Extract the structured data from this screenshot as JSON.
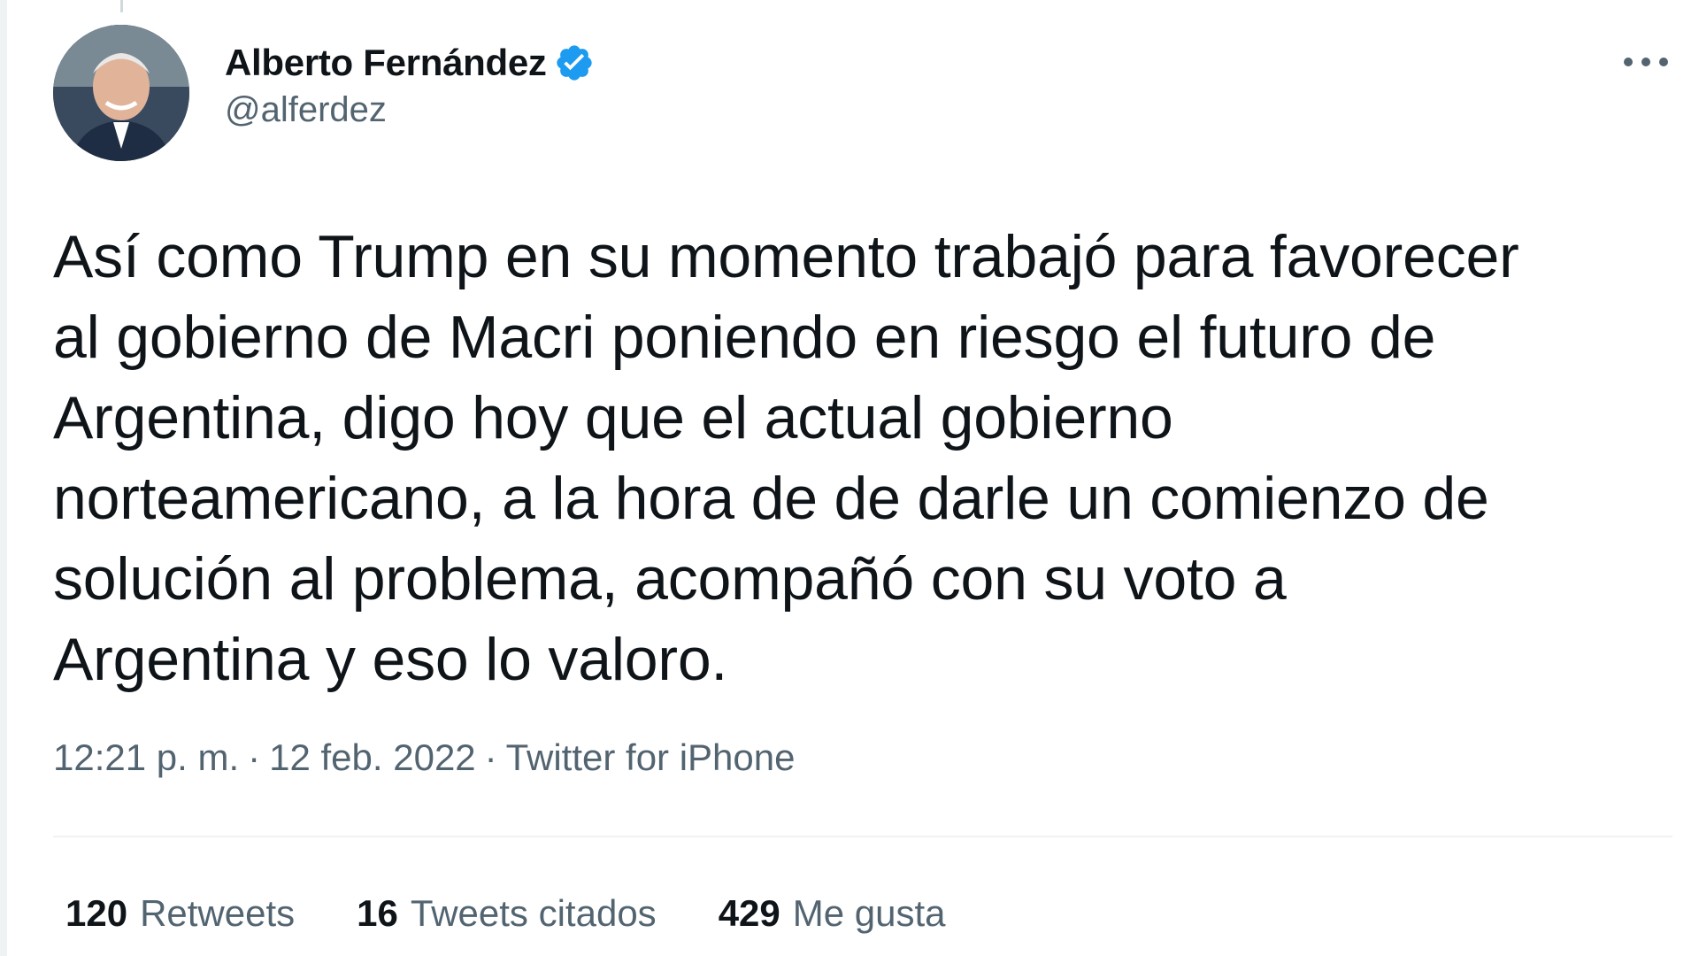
{
  "author": {
    "display_name": "Alberto Fernández",
    "handle": "@alferdez",
    "verified": true,
    "avatar_icon": "profile-photo"
  },
  "tweet": {
    "text": "Así como Trump en su momento trabajó para favorecer\nal gobierno de Macri poniendo en riesgo el futuro de\nArgentina, digo hoy que el actual gobierno\nnorteamericano, a la hora de de darle un comienzo de\nsolución al problema, acompañó con su voto a\nArgentina y eso lo valoro."
  },
  "meta": {
    "time": "12:21 p. m.",
    "separator": "·",
    "date": "12 feb. 2022",
    "source": "Twitter for iPhone"
  },
  "stats": [
    {
      "count": "120",
      "label": "Retweets"
    },
    {
      "count": "16",
      "label": "Tweets citados"
    },
    {
      "count": "429",
      "label": "Me gusta"
    }
  ],
  "colors": {
    "text_primary": "#0f1419",
    "text_secondary": "#536471",
    "verified_blue": "#1d9bf0",
    "divider": "#eff3f4"
  }
}
